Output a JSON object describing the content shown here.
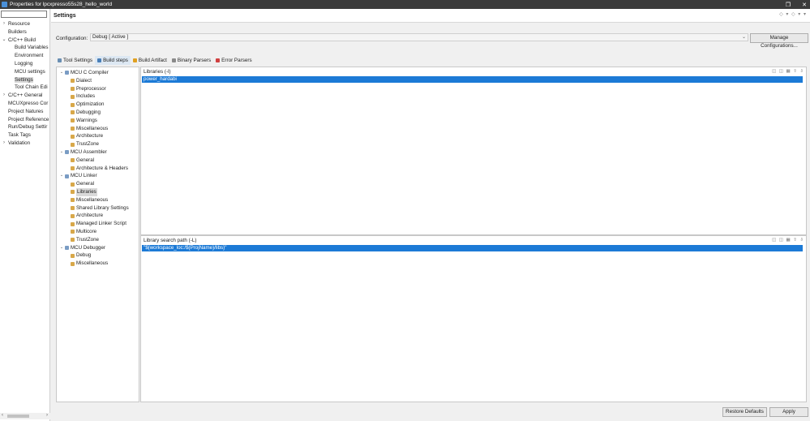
{
  "window": {
    "title": "Properties for lpcxpresso55s28_hello_world",
    "controls": [
      "restore-icon",
      "close-icon"
    ]
  },
  "left_nav": {
    "filter_value": "",
    "items": [
      {
        "label": "Resource",
        "depth": 0,
        "expander": "›"
      },
      {
        "label": "Builders",
        "depth": 1,
        "expander": ""
      },
      {
        "label": "C/C++ Build",
        "depth": 0,
        "expander": "⌄"
      },
      {
        "label": "Build Variables",
        "depth": 2,
        "expander": ""
      },
      {
        "label": "Environment",
        "depth": 2,
        "expander": ""
      },
      {
        "label": "Logging",
        "depth": 2,
        "expander": ""
      },
      {
        "label": "MCU settings",
        "depth": 2,
        "expander": ""
      },
      {
        "label": "Settings",
        "depth": 2,
        "expander": "",
        "selected": true
      },
      {
        "label": "Tool Chain Edi",
        "depth": 2,
        "expander": ""
      },
      {
        "label": "C/C++ General",
        "depth": 0,
        "expander": "›"
      },
      {
        "label": "MCUXpresso Cor",
        "depth": 1,
        "expander": ""
      },
      {
        "label": "Project Natures",
        "depth": 1,
        "expander": ""
      },
      {
        "label": "Project Reference",
        "depth": 1,
        "expander": ""
      },
      {
        "label": "Run/Debug Settir",
        "depth": 1,
        "expander": ""
      },
      {
        "label": "Task Tags",
        "depth": 1,
        "expander": ""
      },
      {
        "label": "Validation",
        "depth": 0,
        "expander": "›"
      }
    ],
    "scroll_left": "‹",
    "scroll_right": "›"
  },
  "header": {
    "title": "Settings",
    "nav": "◇ ▾ ◇ ▾ ▾"
  },
  "configuration": {
    "label": "Configuration:",
    "value": "Debug  [ Active ]",
    "manage_label": "Manage Configurations..."
  },
  "tabs": [
    {
      "label": "Tool Settings",
      "icon": "tool-settings-icon",
      "color": "#6a8fb3",
      "active": false
    },
    {
      "label": "Build steps",
      "icon": "build-steps-icon",
      "color": "#4a7fb8",
      "active": true
    },
    {
      "label": "Build Artifact",
      "icon": "build-artifact-icon",
      "color": "#e0a020",
      "active": false
    },
    {
      "label": "Binary Parsers",
      "icon": "binary-parsers-icon",
      "color": "#8a8a8a",
      "active": false
    },
    {
      "label": "Error Parsers",
      "icon": "error-parsers-icon",
      "color": "#d04040",
      "active": false
    }
  ],
  "tool_tree": [
    {
      "label": "MCU C Compiler",
      "depth": 0,
      "expander": "⌄",
      "icon": "tool-icon"
    },
    {
      "label": "Dialect",
      "depth": 1,
      "icon": "option-icon"
    },
    {
      "label": "Preprocessor",
      "depth": 1,
      "icon": "option-icon"
    },
    {
      "label": "Includes",
      "depth": 1,
      "icon": "option-icon"
    },
    {
      "label": "Optimization",
      "depth": 1,
      "icon": "option-icon"
    },
    {
      "label": "Debugging",
      "depth": 1,
      "icon": "option-icon"
    },
    {
      "label": "Warnings",
      "depth": 1,
      "icon": "option-icon"
    },
    {
      "label": "Miscellaneous",
      "depth": 1,
      "icon": "option-icon"
    },
    {
      "label": "Architecture",
      "depth": 1,
      "icon": "option-icon"
    },
    {
      "label": "TrustZone",
      "depth": 1,
      "icon": "option-icon"
    },
    {
      "label": "MCU Assembler",
      "depth": 0,
      "expander": "⌄",
      "icon": "tool-icon"
    },
    {
      "label": "General",
      "depth": 1,
      "icon": "option-icon"
    },
    {
      "label": "Architecture & Headers",
      "depth": 1,
      "icon": "option-icon"
    },
    {
      "label": "MCU Linker",
      "depth": 0,
      "expander": "⌄",
      "icon": "tool-icon"
    },
    {
      "label": "General",
      "depth": 1,
      "icon": "option-icon"
    },
    {
      "label": "Libraries",
      "depth": 1,
      "icon": "option-icon",
      "selected": true
    },
    {
      "label": "Miscellaneous",
      "depth": 1,
      "icon": "option-icon"
    },
    {
      "label": "Shared Library Settings",
      "depth": 1,
      "icon": "option-icon"
    },
    {
      "label": "Architecture",
      "depth": 1,
      "icon": "option-icon"
    },
    {
      "label": "Managed Linker Script",
      "depth": 1,
      "icon": "option-icon"
    },
    {
      "label": "Multicore",
      "depth": 1,
      "icon": "option-icon"
    },
    {
      "label": "TrustZone",
      "depth": 1,
      "icon": "option-icon"
    },
    {
      "label": "MCU Debugger",
      "depth": 0,
      "expander": "⌄",
      "icon": "tool-icon"
    },
    {
      "label": "Debug",
      "depth": 1,
      "icon": "option-icon"
    },
    {
      "label": "Miscellaneous",
      "depth": 1,
      "icon": "option-icon"
    }
  ],
  "libraries_panel": {
    "title": "Libraries (-l)",
    "items": [
      "power_hardabi"
    ],
    "tools": "◫ ◫ ▦ ⇧ ⇩"
  },
  "search_path_panel": {
    "title": "Library search path (-L)",
    "items": [
      "\"${workspace_loc:/${ProjName}/libs}\""
    ],
    "tools": "◫ ◫ ▦ ⇧ ⇩"
  },
  "buttons": {
    "restore_defaults": "Restore Defaults",
    "apply": "Apply"
  }
}
